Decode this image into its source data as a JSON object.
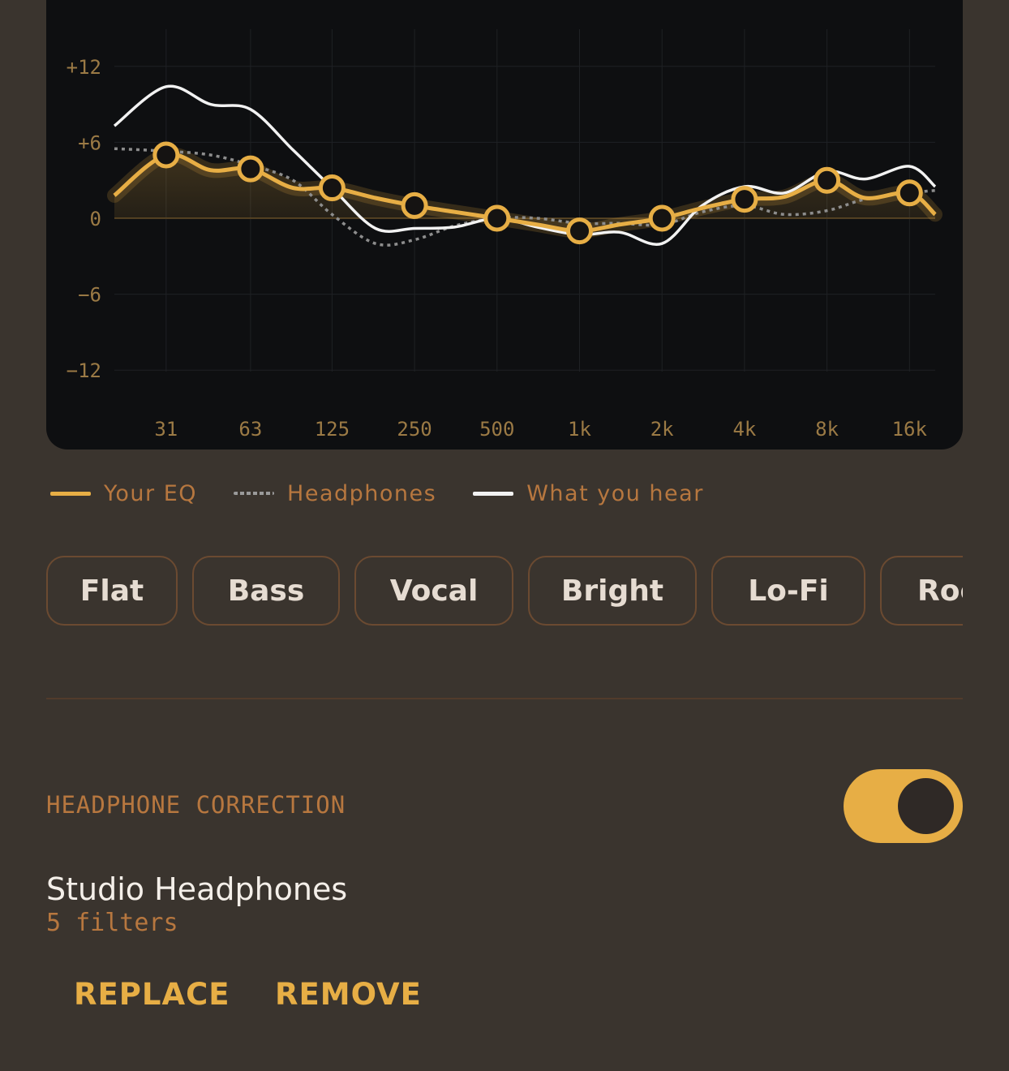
{
  "chart_data": {
    "type": "line",
    "x_ticks": [
      "31",
      "63",
      "125",
      "250",
      "500",
      "1k",
      "2k",
      "4k",
      "8k",
      "16k"
    ],
    "y_ticks": [
      12,
      6,
      0,
      -6,
      -12
    ],
    "y_tick_labels": [
      "+12",
      "+6",
      "0",
      "−6",
      "−12"
    ],
    "ylim": [
      -15,
      15
    ],
    "grid": true,
    "series": [
      {
        "name": "Your EQ",
        "color": "#e7ae45",
        "x": [
          "20",
          "31",
          "45",
          "63",
          "90",
          "125",
          "180",
          "250",
          "350",
          "500",
          "700",
          "1k",
          "1.4k",
          "2k",
          "2.8k",
          "4k",
          "5.6k",
          "8k",
          "11k",
          "16k",
          "20k"
        ],
        "values": [
          1.8,
          5.0,
          3.8,
          3.9,
          2.4,
          2.4,
          1.6,
          1.0,
          0.5,
          0.0,
          -0.5,
          -1.0,
          -0.5,
          0.0,
          0.8,
          1.5,
          1.7,
          3.0,
          1.6,
          2.0,
          0.3
        ]
      },
      {
        "name": "Headphones",
        "color": "#9a9a9a",
        "x": [
          "20",
          "31",
          "45",
          "63",
          "90",
          "125",
          "180",
          "250",
          "350",
          "500",
          "700",
          "1k",
          "1.4k",
          "2k",
          "2.8k",
          "4k",
          "5.6k",
          "8k",
          "11k",
          "16k",
          "20k"
        ],
        "values": [
          5.5,
          5.3,
          5.0,
          4.2,
          3.0,
          0.3,
          -2.0,
          -1.7,
          -0.6,
          0.0,
          0.0,
          -0.4,
          -0.4,
          -0.5,
          0.5,
          1.0,
          0.3,
          0.6,
          1.5,
          2.0,
          2.2
        ]
      },
      {
        "name": "What you hear",
        "color": "#f2f2f2",
        "x": [
          "20",
          "31",
          "45",
          "63",
          "90",
          "125",
          "180",
          "250",
          "350",
          "500",
          "700",
          "1k",
          "1.4k",
          "2k",
          "2.8k",
          "4k",
          "5.6k",
          "8k",
          "11k",
          "16k",
          "20k"
        ],
        "values": [
          7.3,
          10.4,
          9.0,
          8.6,
          5.4,
          2.4,
          -0.8,
          -0.8,
          -0.7,
          0.0,
          -0.7,
          -1.3,
          -1.1,
          -2.0,
          1.0,
          2.5,
          2.0,
          3.7,
          3.1,
          4.1,
          2.5
        ]
      }
    ],
    "eq_bands": [
      {
        "freq": "31",
        "gain": 5.0
      },
      {
        "freq": "63",
        "gain": 3.9
      },
      {
        "freq": "125",
        "gain": 2.4
      },
      {
        "freq": "250",
        "gain": 1.0
      },
      {
        "freq": "500",
        "gain": 0.0
      },
      {
        "freq": "1k",
        "gain": -1.0
      },
      {
        "freq": "2k",
        "gain": 0.0
      },
      {
        "freq": "4k",
        "gain": 1.5
      },
      {
        "freq": "8k",
        "gain": 3.0
      },
      {
        "freq": "16k",
        "gain": 2.0
      }
    ]
  },
  "legend": {
    "eq": "Your EQ",
    "headphones": "Headphones",
    "hear": "What you hear"
  },
  "presets": [
    "Flat",
    "Bass",
    "Vocal",
    "Bright",
    "Lo-Fi",
    "Rock"
  ],
  "correction": {
    "title": "HEADPHONE CORRECTION",
    "enabled": true,
    "device_name": "Studio Headphones",
    "device_detail": "5 filters",
    "replace_label": "REPLACE",
    "remove_label": "REMOVE"
  },
  "colors": {
    "accent": "#e7ae45",
    "background": "#3a342e",
    "graph_bg": "#0e0f11",
    "label": "#b7773f"
  }
}
